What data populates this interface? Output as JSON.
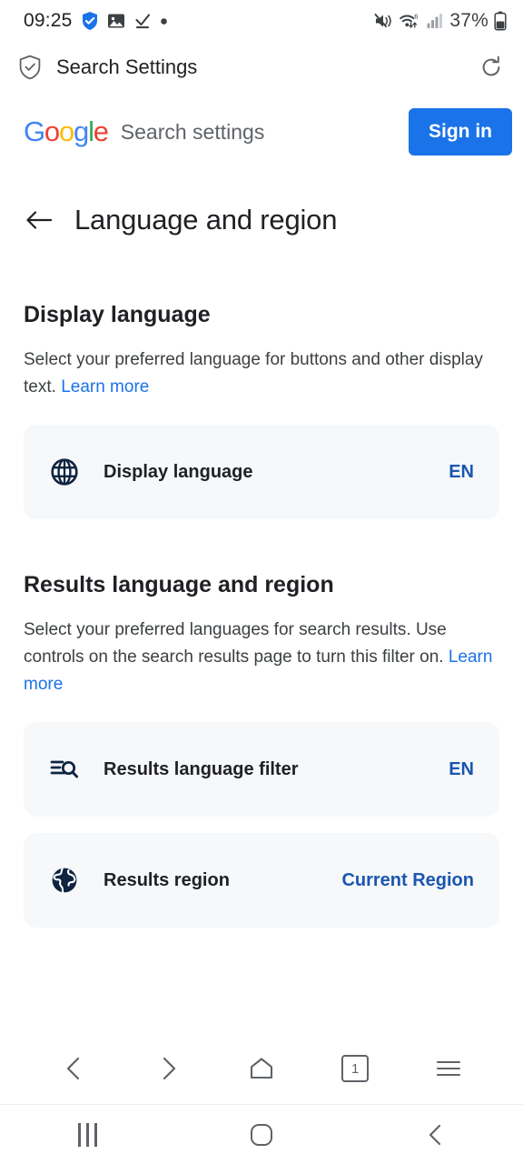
{
  "status_bar": {
    "clock": "09:25",
    "battery_percent": "37%",
    "left_icons": [
      "shield-check-icon",
      "image-icon",
      "download-complete-icon",
      "dot-icon"
    ],
    "right_icons": [
      "volume-muted-icon",
      "wifi-6-icon",
      "cellular-signal-icon",
      "battery-icon"
    ]
  },
  "browser": {
    "title": "Search Settings",
    "security_icon": "shield-check-icon",
    "reload_icon": "refresh-icon",
    "nav": {
      "back_icon": "chevron-left-icon",
      "forward_icon": "chevron-right-icon",
      "home_icon": "home-icon",
      "tab_count": "1",
      "menu_icon": "hamburger-menu-icon"
    }
  },
  "system_nav": {
    "recents_icon": "recent-apps-icon",
    "home_icon": "home-circle-icon",
    "back_icon": "back-chevron-icon"
  },
  "header": {
    "logo_text": "Google",
    "logo_letters": [
      {
        "char": "G",
        "color": "#4285f4"
      },
      {
        "char": "o",
        "color": "#ea4335"
      },
      {
        "char": "o",
        "color": "#fbbc05"
      },
      {
        "char": "g",
        "color": "#4285f4"
      },
      {
        "char": "l",
        "color": "#34a853"
      },
      {
        "char": "e",
        "color": "#ea4335"
      }
    ],
    "product_title": "Search settings",
    "sign_in_label": "Sign in"
  },
  "page": {
    "back_icon": "arrow-left-icon",
    "title": "Language and region"
  },
  "sections": [
    {
      "id": "display-language",
      "title": "Display language",
      "description": "Select your preferred language for buttons and other display text. ",
      "learn_more": "Learn more",
      "cards": [
        {
          "id": "display-language",
          "icon": "globe-icon",
          "label": "Display language",
          "value": "EN"
        }
      ]
    },
    {
      "id": "results-language-and-region",
      "title": "Results language and region",
      "description": "Select your preferred languages for search results. Use controls on the search results page to turn this filter on. ",
      "learn_more": "Learn more",
      "cards": [
        {
          "id": "results-language-filter",
          "icon": "search-filter-icon",
          "label": "Results language filter",
          "value": "EN"
        },
        {
          "id": "results-region",
          "icon": "public-earth-icon",
          "label": "Results region",
          "value": "Current Region"
        }
      ]
    }
  ],
  "colors": {
    "accent_blue": "#1a73e8",
    "value_blue": "#1a56b0",
    "card_bg": "#f6f8fa",
    "icon_navy": "#0e2440",
    "text_primary": "#202124",
    "text_secondary": "#3c4043"
  }
}
